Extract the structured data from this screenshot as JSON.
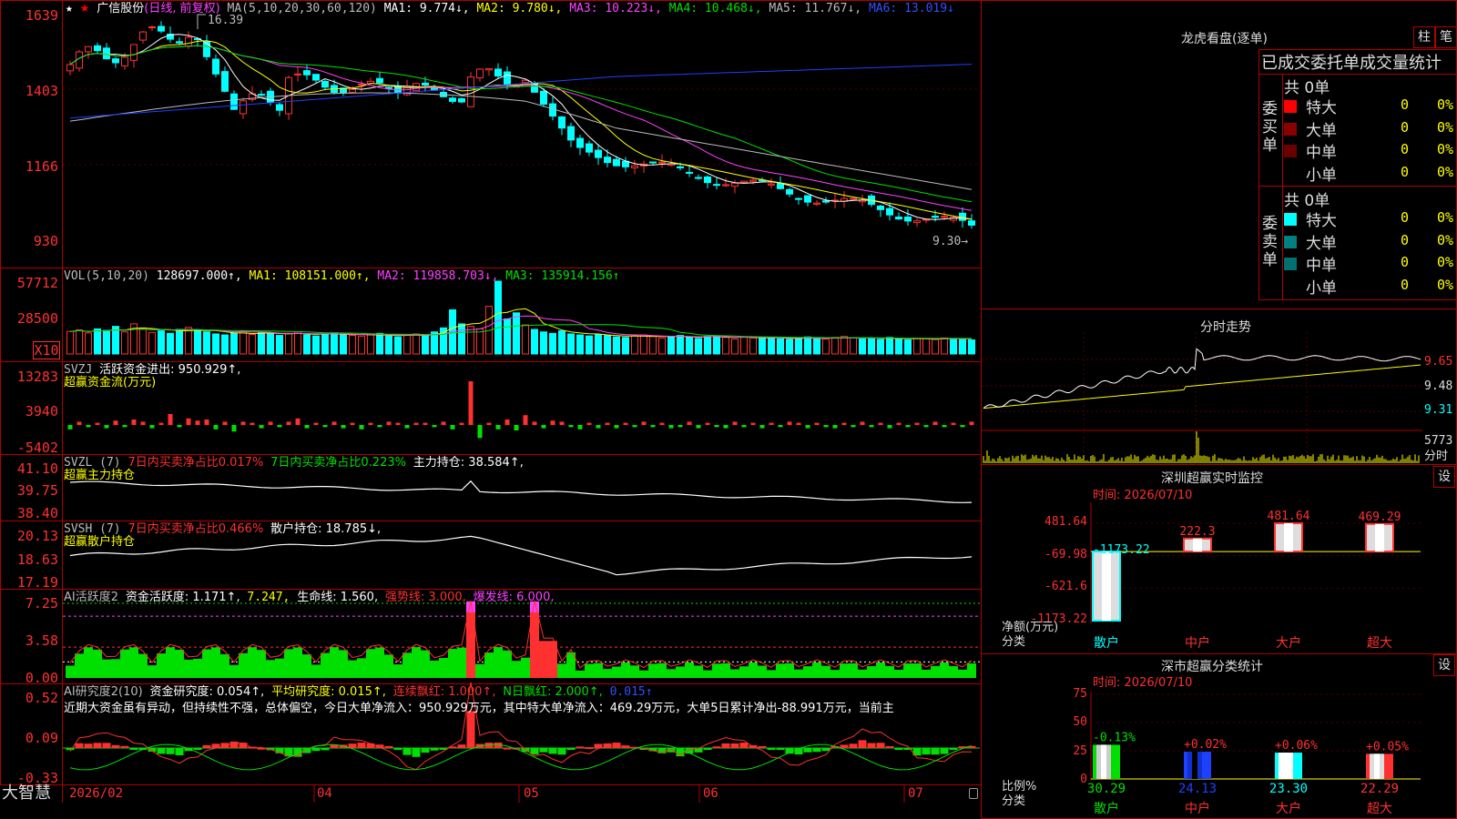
{
  "stock": {
    "name": "广信股份",
    "period": "(日线, 前复权)",
    "star": "★",
    "ma_label": "MA(5,10,20,30,60,120)",
    "ma1": "MA1: 9.774↓,",
    "ma2": "MA2: 9.780↓,",
    "ma3": "MA3: 10.223↓,",
    "ma4": "MA4: 10.468↓,",
    "ma5": "MA5: 11.767↓,",
    "ma6": "MA6: 13.019↓",
    "high_label": "16.39",
    "low_label": "9.30→",
    "axis": [
      "1639",
      "1403",
      "1166",
      "930"
    ]
  },
  "volume": {
    "label": "VOL(5,10,20)",
    "value": "128697.000↑,",
    "ma1": "MA1: 108151.000↑,",
    "ma2": "MA2: 119858.703↓,",
    "ma3": "MA3: 135914.156↑",
    "axis": [
      "57712",
      "28500"
    ],
    "unit": "X10",
    "bars": [
      45,
      48,
      42,
      50,
      47,
      55,
      44,
      60,
      52,
      43,
      46,
      41,
      49,
      53,
      47,
      44,
      40,
      38,
      42,
      45,
      39,
      43,
      40,
      37,
      41,
      44,
      38,
      36,
      40,
      42,
      39,
      37,
      35,
      38,
      41,
      36,
      34,
      37,
      40,
      38,
      44,
      52,
      88,
      60,
      55,
      50,
      95,
      145,
      70,
      82,
      58,
      49,
      44,
      41,
      46,
      40,
      38,
      36,
      39,
      37,
      34,
      33,
      36,
      38,
      35,
      32,
      34,
      37,
      33,
      31,
      35,
      36,
      33,
      30,
      34,
      32,
      31,
      33,
      30,
      29,
      32,
      34,
      31,
      30,
      33,
      35,
      32,
      30,
      31,
      29,
      33,
      30,
      28,
      31,
      30,
      29,
      32,
      31,
      30,
      28
    ]
  },
  "svzj": {
    "label": "SVZJ",
    "title": "活跃资金进出: 950.929↑,",
    "subtitle": "超赢资金流(万元)",
    "axis": [
      "13283",
      "3940",
      "-5402"
    ],
    "bars": [
      -0.4,
      0.3,
      -0.2,
      0.2,
      -0.3,
      0.4,
      -0.2,
      0.5,
      0.3,
      -0.3,
      0.2,
      1.0,
      -0.2,
      0.6,
      0.4,
      0.5,
      -0.4,
      0.3,
      -0.6,
      0.3,
      0.2,
      -0.3,
      0.3,
      -0.2,
      0.3,
      0.6,
      -0.3,
      0.2,
      -0.2,
      0.3,
      -0.3,
      0.2,
      -0.4,
      0.2,
      -0.2,
      0.3,
      0.2,
      -0.3,
      0.2,
      0.2,
      -0.2,
      0.3,
      -0.4,
      0.2,
      4.0,
      -1.2,
      0.2,
      -0.4,
      0.5,
      -0.5,
      0.9,
      0.3,
      -0.3,
      0.4,
      0.3,
      -0.2,
      -0.4,
      0.2,
      -0.3,
      0.2,
      -0.3,
      0.2,
      -0.2,
      0.3,
      -0.2,
      0.2,
      -0.3,
      -0.2,
      0.3,
      -0.3,
      0.2,
      -0.2,
      -0.3,
      0.3,
      -0.2,
      0.2,
      -0.3,
      0.2,
      -0.2,
      0.3,
      0.2,
      -0.3,
      0.2,
      -0.2,
      -0.3,
      0.2,
      -0.2,
      0.3,
      -0.2,
      0.2,
      -0.3,
      0.2,
      -0.2,
      0.2,
      -0.2,
      0.3,
      -0.2,
      0.2,
      -0.2,
      0.3
    ]
  },
  "svzl": {
    "label": "SVZL (7)",
    "buy_ratio_red": "7日内买卖净占比0.017%",
    "buy_ratio_grn": "7日内买卖净占比0.223%",
    "hold": "主力持仓: 38.584↑,",
    "subtitle": "超赢主力持仓",
    "axis": [
      "41.10",
      "39.75",
      "38.40"
    ]
  },
  "svsh": {
    "label": "SVSH (7)",
    "buy_ratio_red": "7日内买卖净占比0.466%",
    "hold": "散户持仓: 18.785↓,",
    "subtitle": "超赢散户持仓",
    "axis": [
      "20.13",
      "18.63",
      "17.19"
    ]
  },
  "ai_active": {
    "label": "AI活跃度2",
    "active": "资金活跃度: 1.171↑,",
    "v2": "7.247,",
    "life": "生命线: 1.560,",
    "strong": "强势线: 3.000,",
    "burst": "爆发线: 6.000,",
    "axis": [
      "7.25",
      "3.58",
      "0.00"
    ]
  },
  "ai_research": {
    "label": "AI研究度2(10)",
    "research": "资金研究度: 0.054↑,",
    "avg": "平均研究度: 0.015↑,",
    "red1": "连续飘红: 1.000↑,",
    "nred": "N日飘红: 2.000↑,",
    "blue": "0.015↑",
    "note": "近期大资金虽有异动，但持续性不强，总体偏空，今日大单净流入：950.929万元，其中特大单净流入：469.29万元，大单5日累计净出-88.991万元，当前主",
    "axis": [
      "0.52",
      "0.09",
      "-0.33"
    ]
  },
  "bottom": {
    "brand": "大智慧",
    "dates": [
      "2026/02",
      "04",
      "05",
      "06",
      "07"
    ]
  },
  "dragon": {
    "title": "龙虎看盘(逐单)",
    "btn1": "柱",
    "btn2": "笔",
    "header": "已成交委托单成交量统计",
    "buy_label": "委买单",
    "sell_label": "委卖单",
    "buy_total": "共 0单",
    "sell_total": "共 0单",
    "buy_rows": [
      {
        "name": "特大",
        "count": "0",
        "pct": "0%",
        "color": "#ff0000"
      },
      {
        "name": "大单",
        "count": "0",
        "pct": "0%",
        "color": "#8b0000"
      },
      {
        "name": "中单",
        "count": "0",
        "pct": "0%",
        "color": "#6a0000"
      },
      {
        "name": "小单",
        "count": "0",
        "pct": "0%",
        "color": "#000000"
      }
    ],
    "sell_rows": [
      {
        "name": "特大",
        "count": "0",
        "pct": "0%",
        "color": "#00ffff"
      },
      {
        "name": "大单",
        "count": "0",
        "pct": "0%",
        "color": "#008080"
      },
      {
        "name": "中单",
        "count": "0",
        "pct": "0%",
        "color": "#007070"
      },
      {
        "name": "小单",
        "count": "0",
        "pct": "0%",
        "color": "#000000"
      }
    ]
  },
  "intraday": {
    "title": "分时走势",
    "axis": [
      "9.65",
      "9.48",
      "9.31"
    ],
    "vol": "5773",
    "unit": "分时"
  },
  "monitor": {
    "title": "深圳超赢实时监控",
    "btn": "设",
    "time": "时间: 2026/07/10",
    "axis": [
      "481.64",
      "-69.98",
      "-621.6",
      "-1173.22"
    ],
    "y_unit": "净额(万元)",
    "x_unit": "分类",
    "categories": [
      "散户",
      "中户",
      "大户",
      "超大"
    ],
    "values": [
      -1173.22,
      222.3,
      481.64,
      469.29
    ],
    "labels": [
      "-1173.22",
      "222.3",
      "481.64",
      "469.29"
    ]
  },
  "classify": {
    "title": "深市超赢分类统计",
    "btn": "设",
    "time": "时间: 2026/07/10",
    "axis": [
      "75",
      "50",
      "25",
      "0"
    ],
    "y_unit": "比例%",
    "x_unit": "分类",
    "categories": [
      "散户",
      "中户",
      "大户",
      "超大"
    ],
    "values": [
      30.29,
      24.13,
      23.3,
      22.29
    ],
    "labels": [
      "30.29",
      "24.13",
      "23.30",
      "22.29"
    ],
    "changes": [
      "-0.13%",
      "+0.02%",
      "+0.06%",
      "+0.05%"
    ],
    "colors": [
      "#00e000",
      "#2040ff",
      "#00ffff",
      "#ff3030"
    ]
  }
}
